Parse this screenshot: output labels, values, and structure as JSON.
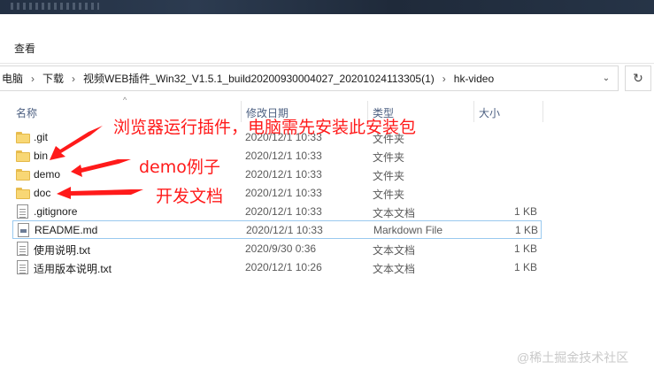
{
  "ribbon": {
    "view_tab": "查看"
  },
  "address": {
    "crumbs": [
      "电脑",
      "下载",
      "视频WEB插件_Win32_V1.5.1_build20200930004027_20201024113305(1)",
      "hk-video"
    ]
  },
  "columns": {
    "name": "名称",
    "date": "修改日期",
    "type": "类型",
    "size": "大小"
  },
  "files": [
    {
      "name": ".git",
      "date": "2020/12/1 10:33",
      "type": "文件夹",
      "size": "",
      "icon": "folder-icon"
    },
    {
      "name": "bin",
      "date": "2020/12/1 10:33",
      "type": "文件夹",
      "size": "",
      "icon": "folder-icon"
    },
    {
      "name": "demo",
      "date": "2020/12/1 10:33",
      "type": "文件夹",
      "size": "",
      "icon": "folder-icon"
    },
    {
      "name": "doc",
      "date": "2020/12/1 10:33",
      "type": "文件夹",
      "size": "",
      "icon": "folder-icon"
    },
    {
      "name": ".gitignore",
      "date": "2020/12/1 10:33",
      "type": "文本文档",
      "size": "1 KB",
      "icon": "text-file-icon"
    },
    {
      "name": "README.md",
      "date": "2020/12/1 10:33",
      "type": "Markdown File",
      "size": "1 KB",
      "icon": "markdown-file-icon"
    },
    {
      "name": "使用说明.txt",
      "date": "2020/9/30 0:36",
      "type": "文本文档",
      "size": "1 KB",
      "icon": "text-file-icon"
    },
    {
      "name": "适用版本说明.txt",
      "date": "2020/12/1 10:26",
      "type": "文本文档",
      "size": "1 KB",
      "icon": "text-file-icon"
    }
  ],
  "selected_row": "README.md",
  "annotations": {
    "bin_note": "浏览器运行插件，电脑需先安装此安装包",
    "demo_note": "demo例子",
    "doc_note": "开发文档"
  },
  "watermark": "@稀土掘金技术社区",
  "colors": {
    "annotation": "#ff1a1a",
    "header_text": "#4d6082",
    "selection_border": "#99c9ef",
    "folder": "#f8d775"
  }
}
